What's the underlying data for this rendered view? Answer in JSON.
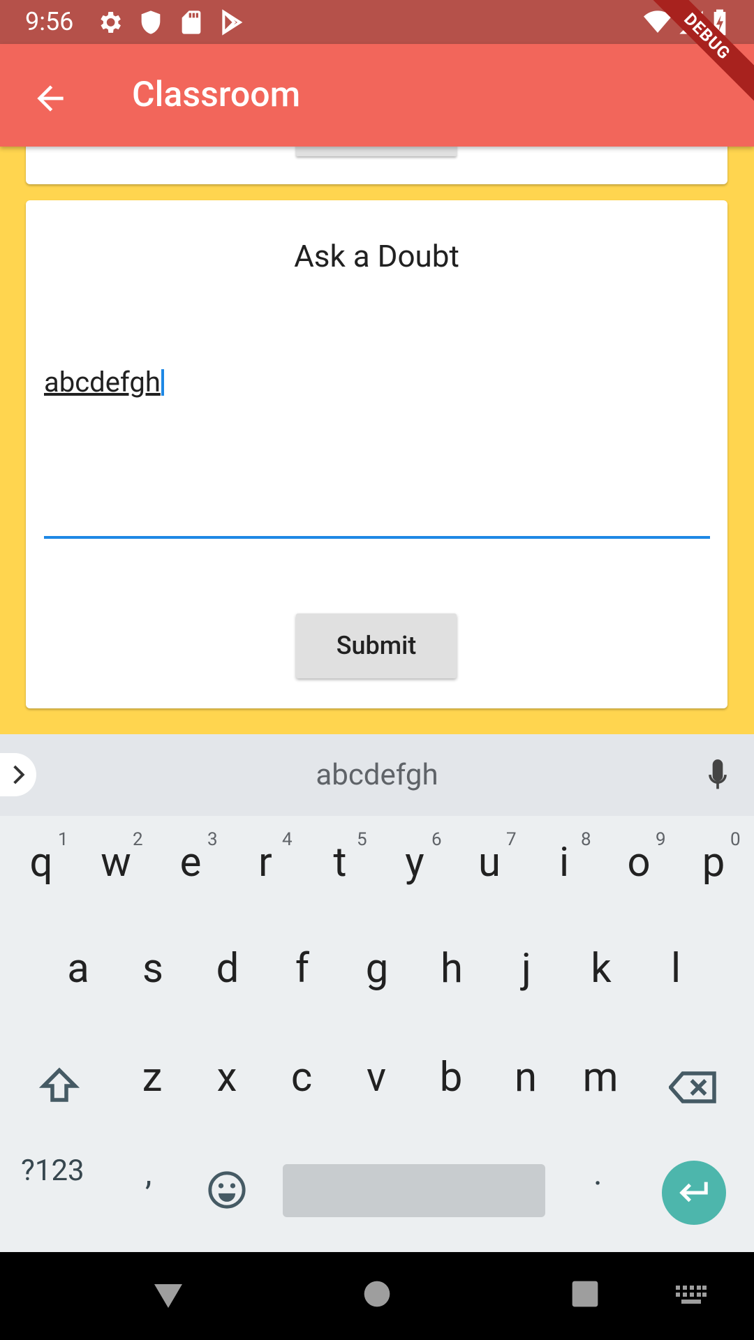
{
  "status_bar": {
    "time": "9:56"
  },
  "app_bar": {
    "title": "Classroom"
  },
  "debug_banner": "DEBUG",
  "ask_card": {
    "heading": "Ask a Doubt",
    "input_value": "abcdefgh",
    "submit_label": "Submit"
  },
  "keyboard": {
    "suggestion": "abcdefgh",
    "row1": [
      {
        "k": "q",
        "h": "1"
      },
      {
        "k": "w",
        "h": "2"
      },
      {
        "k": "e",
        "h": "3"
      },
      {
        "k": "r",
        "h": "4"
      },
      {
        "k": "t",
        "h": "5"
      },
      {
        "k": "y",
        "h": "6"
      },
      {
        "k": "u",
        "h": "7"
      },
      {
        "k": "i",
        "h": "8"
      },
      {
        "k": "o",
        "h": "9"
      },
      {
        "k": "p",
        "h": "0"
      }
    ],
    "row2": [
      "a",
      "s",
      "d",
      "f",
      "g",
      "h",
      "j",
      "k",
      "l"
    ],
    "row3": [
      "z",
      "x",
      "c",
      "v",
      "b",
      "n",
      "m"
    ],
    "symbols_label": "?123",
    "comma": ",",
    "period": "."
  },
  "colors": {
    "status_bar": "#B5514A",
    "app_bar": "#F2665B",
    "background": "#FFD54F",
    "accent": "#1E88E5",
    "enter_key": "#4DB6AC"
  }
}
